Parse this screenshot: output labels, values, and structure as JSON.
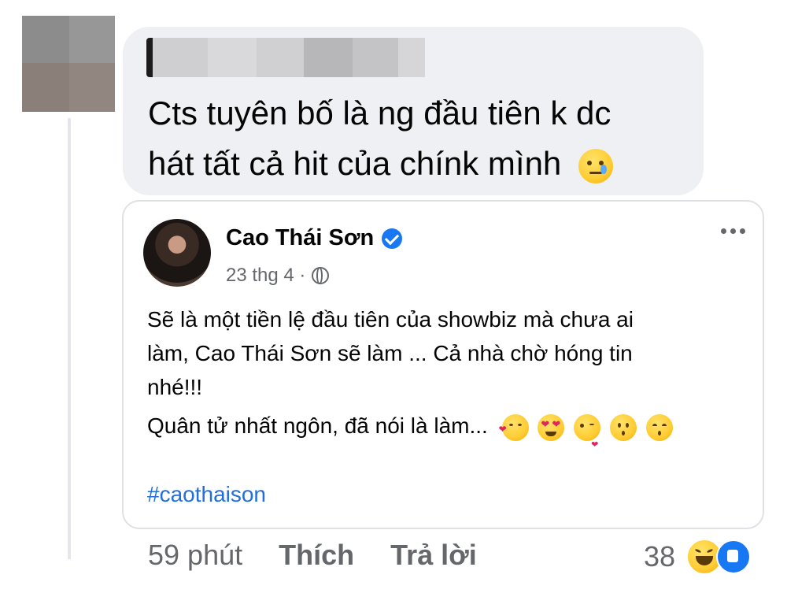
{
  "comment": {
    "text_line1": "Cts tuyên bố là ng đầu tiên k dc",
    "text_line2": "hát tất cả hit của chínk mình",
    "emoji": "sad-tear-emoji"
  },
  "post": {
    "author": "Cao Thái Sơn",
    "date": "23 thg 4 ·",
    "line1": "Sẽ là một tiền lệ đầu tiên của showbiz mà chưa ai",
    "line2": "làm, Cao Thái Sơn sẽ làm ... Cả nhà chờ hóng tin",
    "line3": "nhé!!!",
    "line4": "Quân tử nhất ngôn, đã nói là làm...",
    "emojis": [
      "smiling-hearts-emoji",
      "heart-eyes-emoji",
      "kiss-emoji",
      "kissing-emoji",
      "kissing-smiling-eyes-emoji"
    ],
    "hashtag": "#caothaison"
  },
  "footer": {
    "time": "59 phút",
    "like": "Thích",
    "reply": "Trả lời",
    "reaction_count": "38"
  },
  "colors": {
    "bubble": "#eef0f3",
    "link": "#216fdb",
    "muted": "#65676b",
    "brand": "#1877f2"
  }
}
